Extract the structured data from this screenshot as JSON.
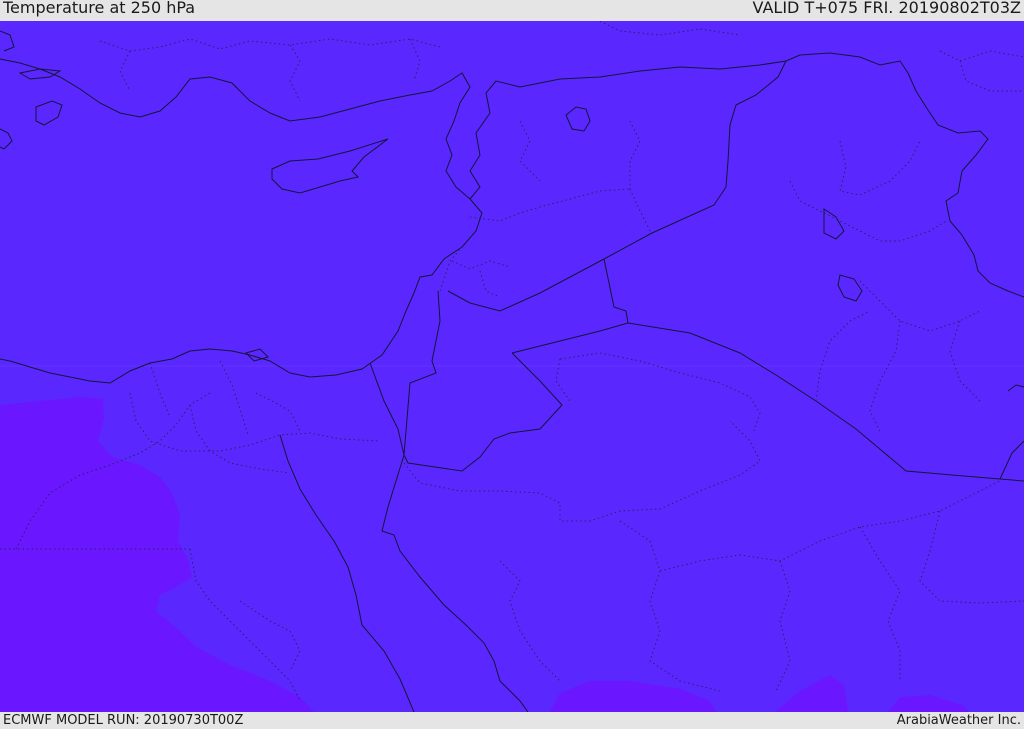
{
  "header": {
    "title": "Temperature at 250 hPa",
    "valid_time": "VALID T+075 FRI. 20190802T03Z"
  },
  "footer": {
    "model_run": "ECMWF MODEL RUN: 20190730T00Z",
    "credit": "ArabiaWeather Inc."
  },
  "map": {
    "field": "temperature",
    "level": "250 hPa",
    "colors": {
      "main_fill": "#5a28ff",
      "warm_fill": "#6a16ff",
      "border_line": "#1a1a3a",
      "admin_line": "#2a2060",
      "background": "#e5e5e5"
    }
  }
}
